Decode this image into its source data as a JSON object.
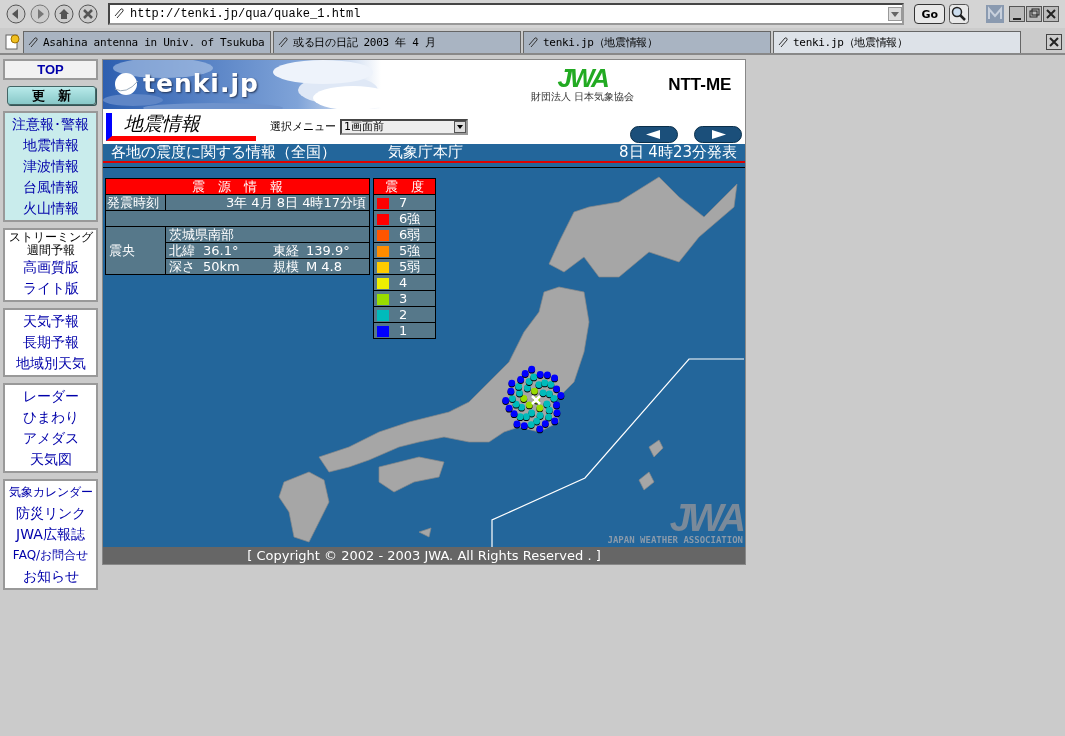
{
  "toolbar": {
    "url": "http://tenki.jp/qua/quake_1.html",
    "go_button": "Go"
  },
  "tabs": [
    {
      "label": "Asahina antenna in Univ. of Tsukuba",
      "selected": false
    },
    {
      "label": "或る日の日記 2003 年 4 月",
      "selected": false
    },
    {
      "label": "tenki.jp（地震情報）",
      "selected": false
    },
    {
      "label": "tenki.jp（地震情報）",
      "selected": true
    }
  ],
  "sidebar": {
    "top": "TOP",
    "refresh": "更　新",
    "groups": [
      {
        "kind": "tinted",
        "items": [
          {
            "label": "注意報･警報",
            "kind": "link"
          },
          {
            "label": "地震情報",
            "kind": "link"
          },
          {
            "label": "津波情報",
            "kind": "link"
          },
          {
            "label": "台風情報",
            "kind": "link"
          },
          {
            "label": "火山情報",
            "kind": "link"
          }
        ]
      },
      {
        "kind": "plain",
        "items": [
          {
            "label": "ストリーミング",
            "kind": "caption"
          },
          {
            "label": "週間予報",
            "kind": "caption"
          },
          {
            "label": "高画質版",
            "kind": "link"
          },
          {
            "label": "ライト版",
            "kind": "link"
          }
        ]
      },
      {
        "kind": "plain",
        "items": [
          {
            "label": "天気予報",
            "kind": "link"
          },
          {
            "label": "長期予報",
            "kind": "link"
          },
          {
            "label": "地域別天気",
            "kind": "link"
          }
        ]
      },
      {
        "kind": "plain",
        "items": [
          {
            "label": "レーダー",
            "kind": "link"
          },
          {
            "label": "ひまわり",
            "kind": "link"
          },
          {
            "label": "アメダス",
            "kind": "link"
          },
          {
            "label": "天気図",
            "kind": "link"
          }
        ]
      },
      {
        "kind": "plain",
        "items": [
          {
            "label": "気象カレンダー",
            "kind": "small"
          },
          {
            "label": "防災リンク",
            "kind": "link"
          },
          {
            "label": "JWA広報誌",
            "kind": "link"
          },
          {
            "label": "FAQ/お問合せ",
            "kind": "small"
          },
          {
            "label": "お知らせ",
            "kind": "link"
          }
        ]
      }
    ]
  },
  "page": {
    "logo": "tenki.jp",
    "sponsor_logo": "JWA",
    "sponsor_caption": "財団法人 日本気象協会",
    "partner": "NTT-ME",
    "title": "地震情報",
    "menu_label": "選択メニュー",
    "menu_value": "1画面前",
    "banner": {
      "heading": "各地の震度に関する情報（全国）",
      "source": "気象庁本庁",
      "issued": "8日 4時23分発表"
    },
    "epicenter": {
      "title": "震　源　情　報",
      "time_label": "発震時刻",
      "time": "3年 4月 8日 4時17分頃",
      "place_label": "震央",
      "region": "茨城県南部",
      "lat_label": "北緯",
      "lat": "36.1°",
      "lon_label": "東経",
      "lon": "139.9°",
      "depth_label": "深さ",
      "depth": "50km",
      "magnitude_label": "規模",
      "magnitude": "M 4.8"
    },
    "legend": {
      "title": "震　度",
      "levels": [
        {
          "label": "7",
          "color": "#ff0000"
        },
        {
          "label": "6強",
          "color": "#ff0000"
        },
        {
          "label": "6弱",
          "color": "#ff5500"
        },
        {
          "label": "5強",
          "color": "#ff8c00"
        },
        {
          "label": "5弱",
          "color": "#ffcc00"
        },
        {
          "label": "4",
          "color": "#eeee00"
        },
        {
          "label": "3",
          "color": "#99dd00"
        },
        {
          "label": "2",
          "color": "#00bbbb"
        },
        {
          "label": "1",
          "color": "#0000ff"
        }
      ]
    },
    "map_logo": "JWA",
    "map_credit": "JAPAN WEATHER ASSOCIATION",
    "copyright": "[ Copyright © 2002 - 2003 JWA. All Rights Reserved . ]"
  }
}
